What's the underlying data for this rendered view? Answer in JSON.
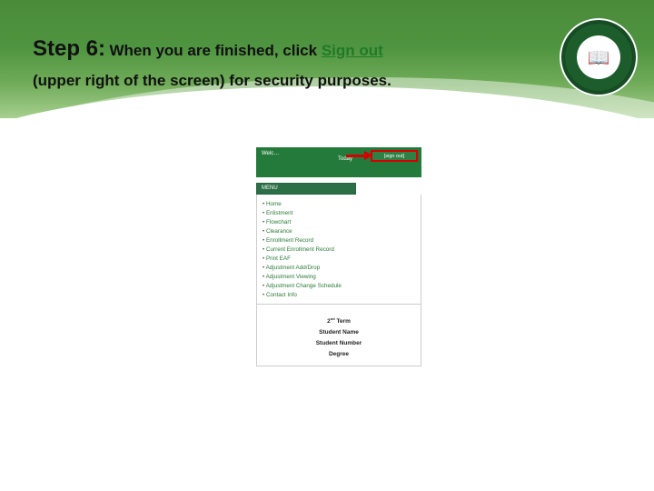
{
  "heading": {
    "step_label": "Step 6:",
    "body_before": "When you are finished, click ",
    "highlight": "Sign out",
    "line2": "(upper right of the screen) for security purposes."
  },
  "seal_glyph": "📖",
  "shot": {
    "welcome": "Welc…",
    "today": "Today",
    "signout": "[sign out]",
    "menu_label": "MENU",
    "menu_items": [
      "Home",
      "Enlistment",
      "Flowchart",
      "Clearance",
      "Enrollment Record",
      "Current Enrollment Record",
      "Print EAF",
      "Adjustment Add/Drop",
      "Adjustment Viewing",
      "Adjustment Change Schedule",
      "Contact Info"
    ],
    "info": {
      "term_prefix": "2",
      "term_suffix": "nd",
      "term_after": " Term",
      "name_label": "Student Name",
      "number_label": "Student Number",
      "degree_label": "Degree"
    }
  }
}
